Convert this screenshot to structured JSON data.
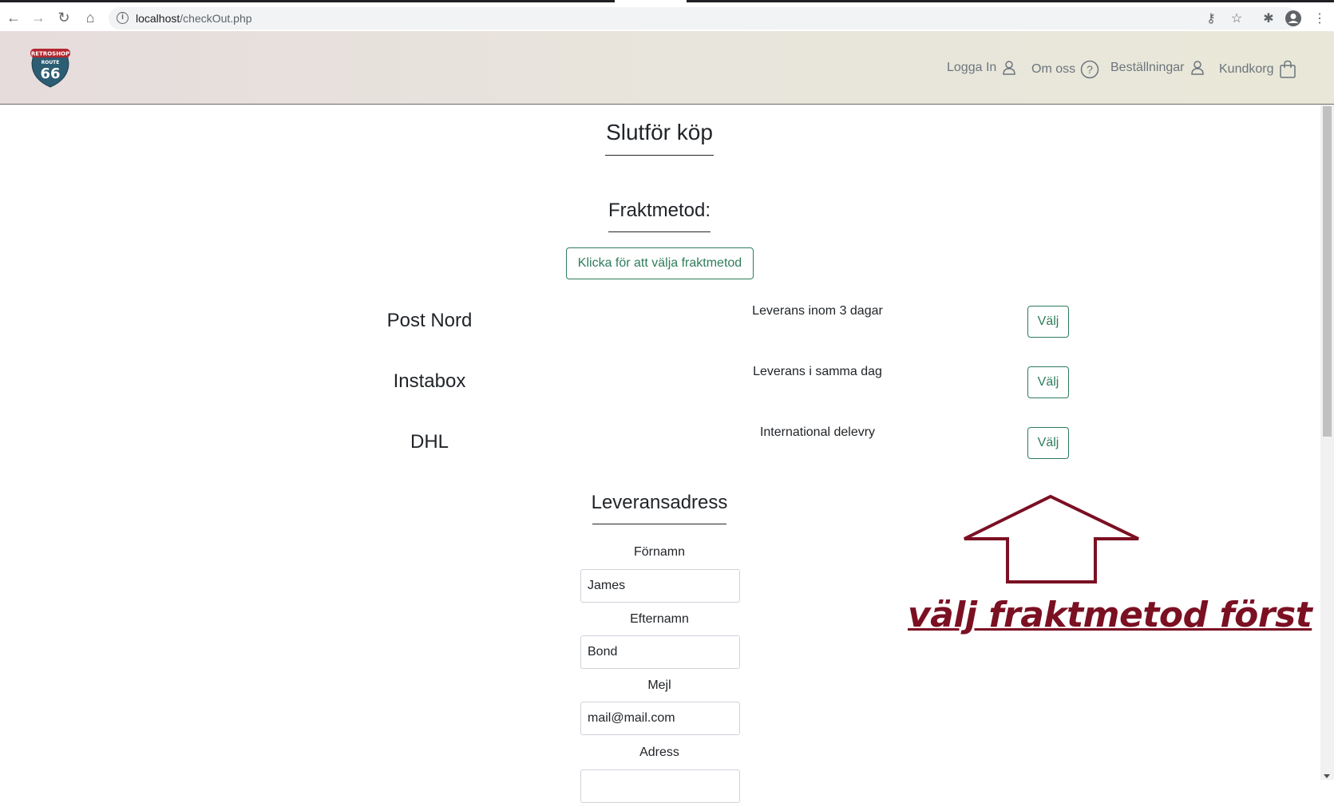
{
  "browser": {
    "url_host": "localhost",
    "url_path": "/checkOut.php"
  },
  "header": {
    "logo": {
      "brand": "RETROSHOP",
      "route": "ROUTE",
      "number": "66"
    },
    "nav": [
      {
        "label": "Logga In",
        "icon": "user-icon"
      },
      {
        "label": "Om oss",
        "icon": "question-circle-icon"
      },
      {
        "label": "Beställningar",
        "icon": "user-icon"
      },
      {
        "label": "Kundkorg",
        "icon": "shopping-bag-icon"
      }
    ]
  },
  "main": {
    "title": "Slutför köp",
    "shipping_heading": "Fraktmetod:",
    "choose_shipping_button": "Klicka för att välja fraktmetod",
    "carriers": [
      {
        "name": "Post Nord",
        "description": "Leverans inom 3 dagar",
        "button": "Välj"
      },
      {
        "name": "Instabox",
        "description": "Leverans i samma dag",
        "button": "Välj"
      },
      {
        "name": "DHL",
        "description": "International delevry",
        "button": "Välj"
      }
    ],
    "address_heading": "Leveransadress",
    "fields": [
      {
        "label": "Förnamn",
        "value": "James"
      },
      {
        "label": "Efternamn",
        "value": "Bond"
      },
      {
        "label": "Mejl",
        "value": "mail@mail.com"
      },
      {
        "label": "Adress",
        "value": ""
      }
    ]
  },
  "annotation": {
    "text": "välj fraktmetod först",
    "color": "#7b1023"
  },
  "colors": {
    "accent_green": "#2e7d5b",
    "nav_text": "#6c757d"
  }
}
